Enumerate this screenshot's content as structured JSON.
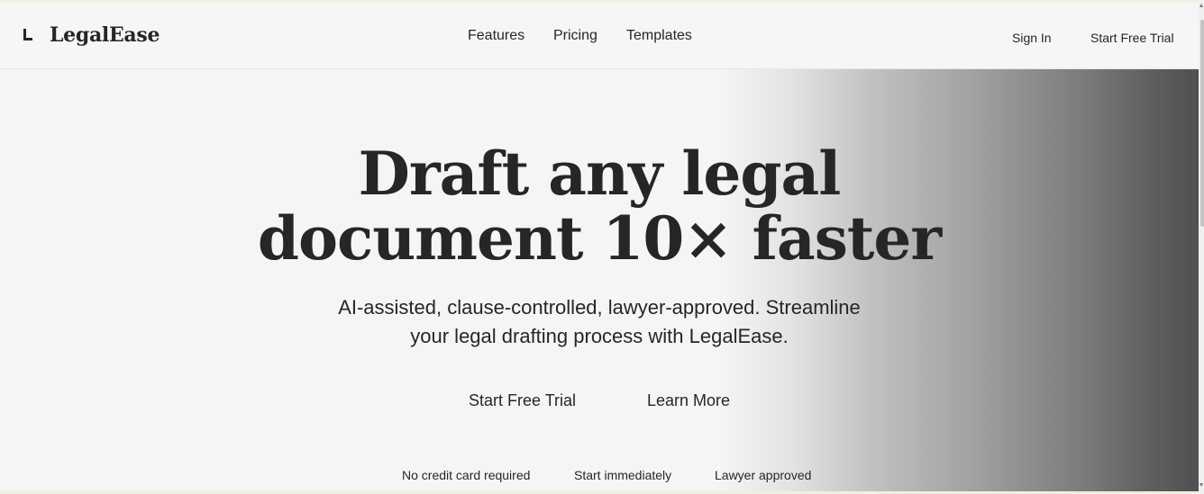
{
  "header": {
    "brand": "LegalEase",
    "logo_icon": "l-bracket-logo-icon",
    "nav": {
      "features": "Features",
      "pricing": "Pricing",
      "templates": "Templates"
    },
    "sign_in": "Sign In",
    "start_trial": "Start Free Trial"
  },
  "hero": {
    "title_line1": "Draft any legal",
    "title_line2": "document 10× faster",
    "subtitle_line1": "AI-assisted, clause-controlled, lawyer-approved. Streamline",
    "subtitle_line2": "your legal drafting process with LegalEase.",
    "primary_cta": "Start Free Trial",
    "secondary_cta": "Learn More",
    "perks": [
      "No credit card required",
      "Start immediately",
      "Lawyer approved"
    ]
  },
  "colors": {
    "text": "#262626",
    "background": "#f5f5f5",
    "gradient_dark": "#505050"
  }
}
